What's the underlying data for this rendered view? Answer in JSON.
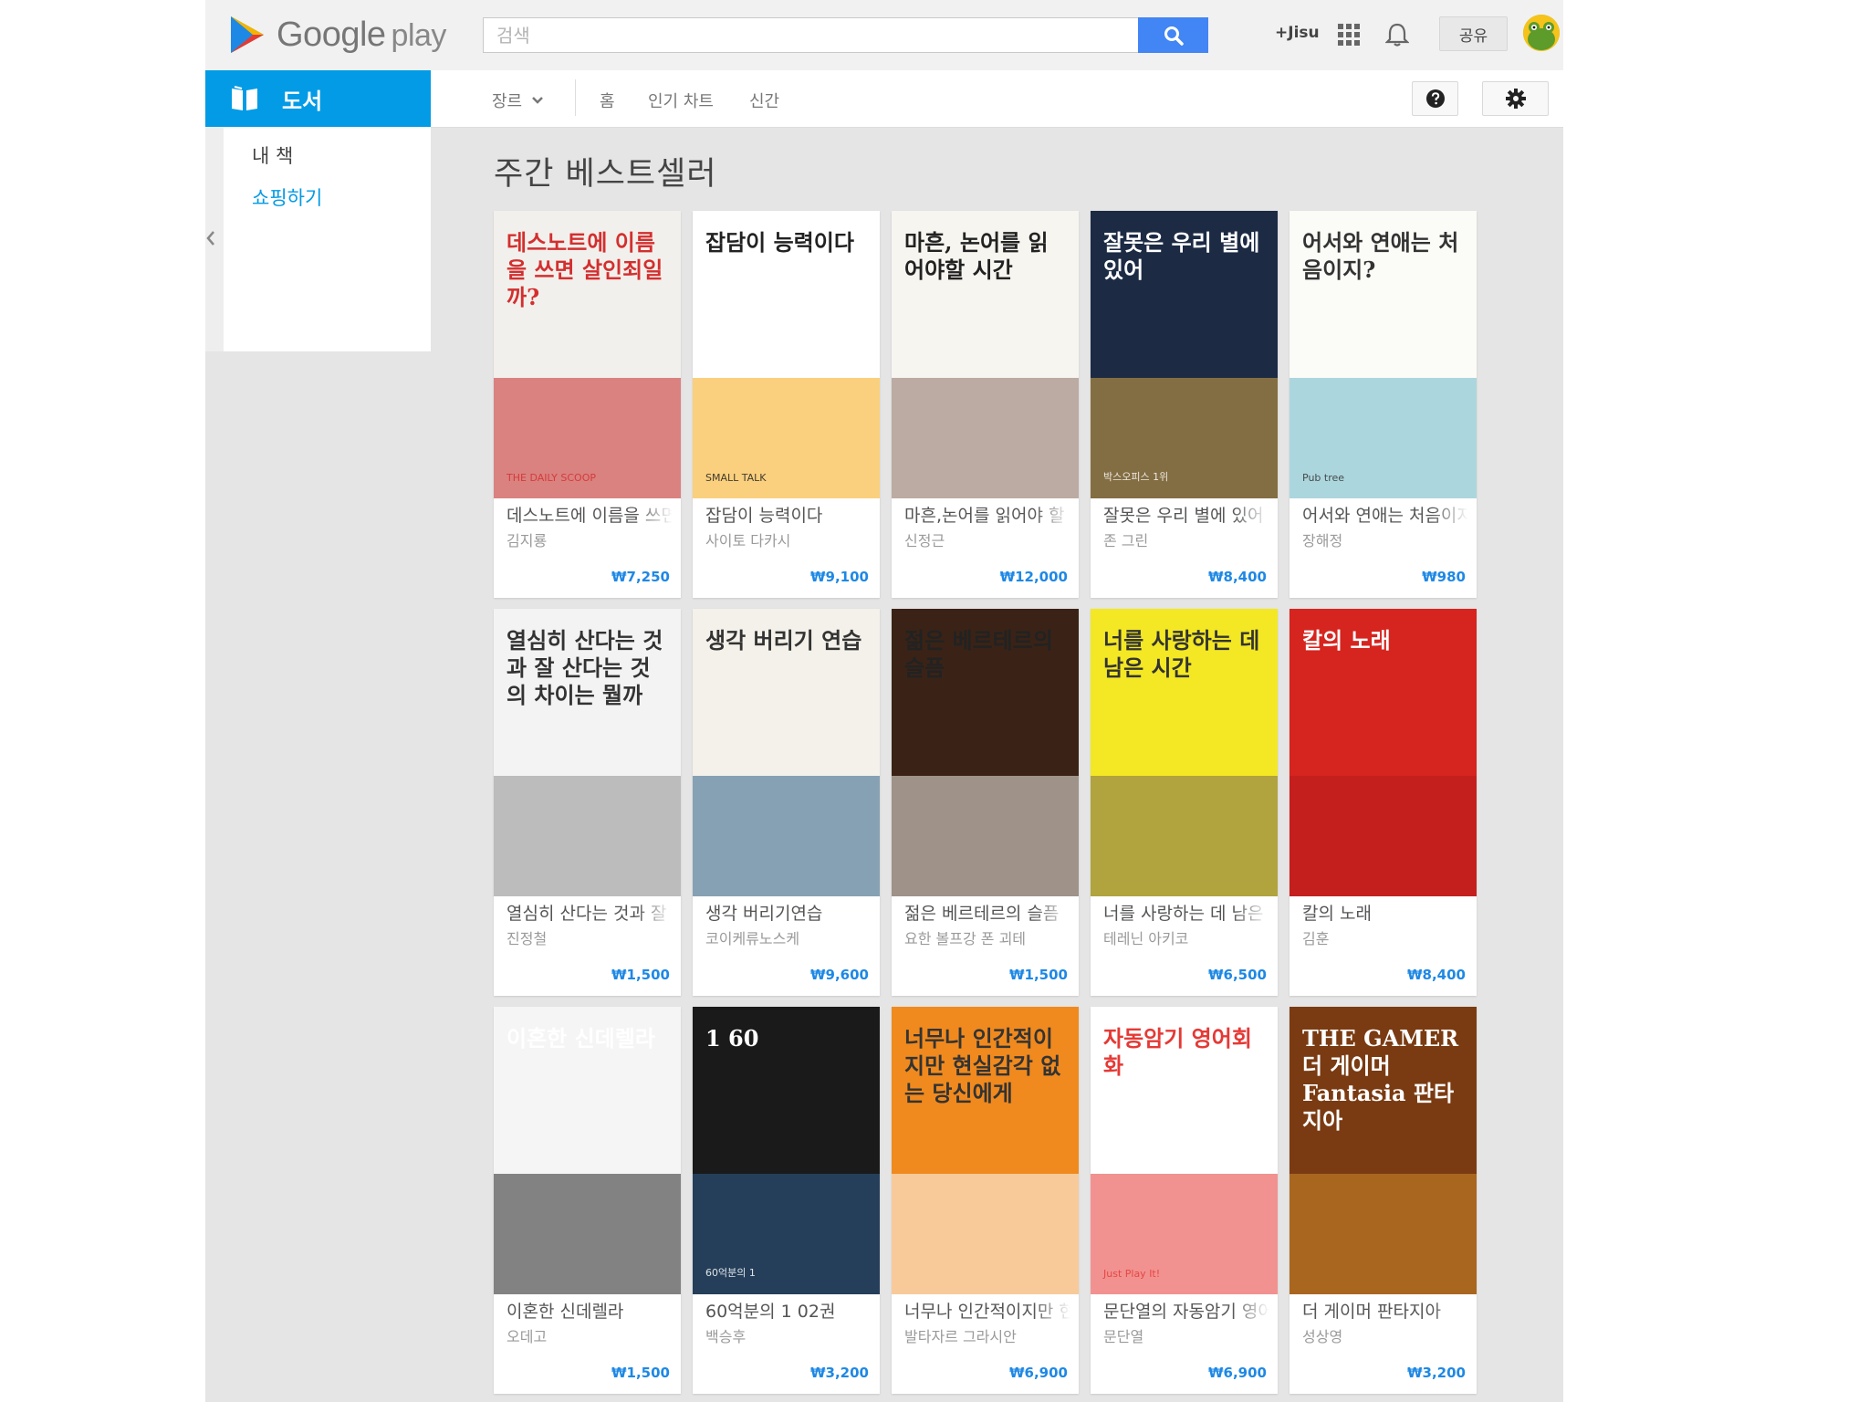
{
  "topbar": {
    "logo_word": "Google",
    "logo_play": "play",
    "search_placeholder": "검색",
    "user_link": "+Jisu",
    "share_label": "공유"
  },
  "category": {
    "label": "도서"
  },
  "subnav": {
    "genre_label": "장르",
    "links": [
      "홈",
      "인기 차트",
      "신간"
    ]
  },
  "sidebar": {
    "items": [
      "내 책",
      "쇼핑하기"
    ]
  },
  "main": {
    "heading": "주간 베스트셀러",
    "books": [
      {
        "title": "데스노트에 이름을 쓰면 살인죄일까?",
        "author": "김지룡",
        "price": "₩7,250",
        "cover_text": "데스노트에 이름을 쓰면 살인죄일까?",
        "cover_small": "THE DAILY SCOOP",
        "bg": "#f2f0ec",
        "fg": "#d32f2f",
        "accent": "#c62828"
      },
      {
        "title": "잡담이 능력이다",
        "author": "사이토 다카시",
        "price": "₩9,100",
        "cover_text": "잡담이 능력이다",
        "cover_small": "SMALL TALK",
        "bg": "#ffffff",
        "fg": "#222222",
        "accent": "#f5a914"
      },
      {
        "title": "마흔,논어를 읽어야 할 시간",
        "author": "신정근",
        "price": "₩12,000",
        "cover_text": "마흔, 논어를 읽어야할 시간",
        "cover_small": "",
        "bg": "#f7f5f0",
        "fg": "#222222",
        "accent": "#8d6e63"
      },
      {
        "title": "잘못은 우리 별에 있어",
        "author": "존 그린",
        "price": "₩8,400",
        "cover_text": "잘못은 우리 별에 있어",
        "cover_small": "박스오피스 1위",
        "bg": "#1c2a44",
        "fg": "#ffffff",
        "accent": "#d9a441"
      },
      {
        "title": "어서와 연애는 처음이지?",
        "author": "장해정",
        "price": "₩980",
        "cover_text": "어서와 연애는 처음이지?",
        "cover_small": "Pub tree",
        "bg": "#fbfbf7",
        "fg": "#333333",
        "accent": "#6bb8c9"
      },
      {
        "title": "열심히 산다는 것과 잘 산다는 것의 차이는 뭘까",
        "author": "진정철",
        "price": "₩1,500",
        "cover_text": "열심히 산다는 것과 잘 산다는 것의 차이는 뭘까",
        "cover_small": "",
        "bg": "#f3f3f3",
        "fg": "#333333",
        "accent": "#8e8e8e"
      },
      {
        "title": "생각 버리기연습",
        "author": "코이케류노스케",
        "price": "₩9,600",
        "cover_text": "생각 버리기 연습",
        "cover_small": "",
        "bg": "#f4f1ea",
        "fg": "#333333",
        "accent": "#2d5f86"
      },
      {
        "title": "젊은 베르테르의 슬픔",
        "author": "요한 볼프강 폰 괴테",
        "price": "₩1,500",
        "cover_text": "젊은 베르테르의 슬픔",
        "cover_small": "",
        "bg": "#3a2316",
        "fg": "#222222",
        "accent": "#f2efe8"
      },
      {
        "title": "너를 사랑하는 데 남은 시간",
        "author": "테레닌 아키코",
        "price": "₩6,500",
        "cover_text": "너를 사랑하는 데 남은 시간",
        "cover_small": "",
        "bg": "#f3e823",
        "fg": "#333333",
        "accent": "#7a6a55"
      },
      {
        "title": "칼의 노래",
        "author": "김훈",
        "price": "₩8,400",
        "cover_text": "칼의 노래",
        "cover_small": "",
        "bg": "#d6241f",
        "fg": "#ffffff",
        "accent": "#b71c1c"
      },
      {
        "title": "이혼한 신데렐라",
        "author": "오데고",
        "price": "₩1,500",
        "cover_text": "이혼한 신데렐라",
        "cover_small": "",
        "bg": "#f5f5f5",
        "fg": "#ffffff",
        "accent": "#222222"
      },
      {
        "title": "60억분의 1 02권",
        "author": "백승후",
        "price": "₩3,200",
        "cover_text": "1 60",
        "cover_small": "60억분의 1",
        "bg": "#1a1a1a",
        "fg": "#ffffff",
        "accent": "#2f5f8f"
      },
      {
        "title": "너무나 인간적이지만 현실감각 없는 당신에게",
        "author": "발타자르 그라시안",
        "price": "₩6,900",
        "cover_text": "너무나 인간적이지만 현실감각 없는 당신에게",
        "cover_small": "",
        "bg": "#f08a1e",
        "fg": "#333333",
        "accent": "#ffffff"
      },
      {
        "title": "문단열의 자동암기 영어회화",
        "author": "문단열",
        "price": "₩6,900",
        "cover_text": "자동암기 영어회화",
        "cover_small": "Just Play It!",
        "bg": "#ffffff",
        "fg": "#e53935",
        "accent": "#e53935"
      },
      {
        "title": "더 게이머 판타지아",
        "author": "성상영",
        "price": "₩3,200",
        "cover_text": "THE GAMER 더 게이머 Fantasia 판타지아",
        "cover_small": "",
        "bg": "#7a3b12",
        "fg": "#ffffff",
        "accent": "#d08a2a"
      }
    ]
  }
}
